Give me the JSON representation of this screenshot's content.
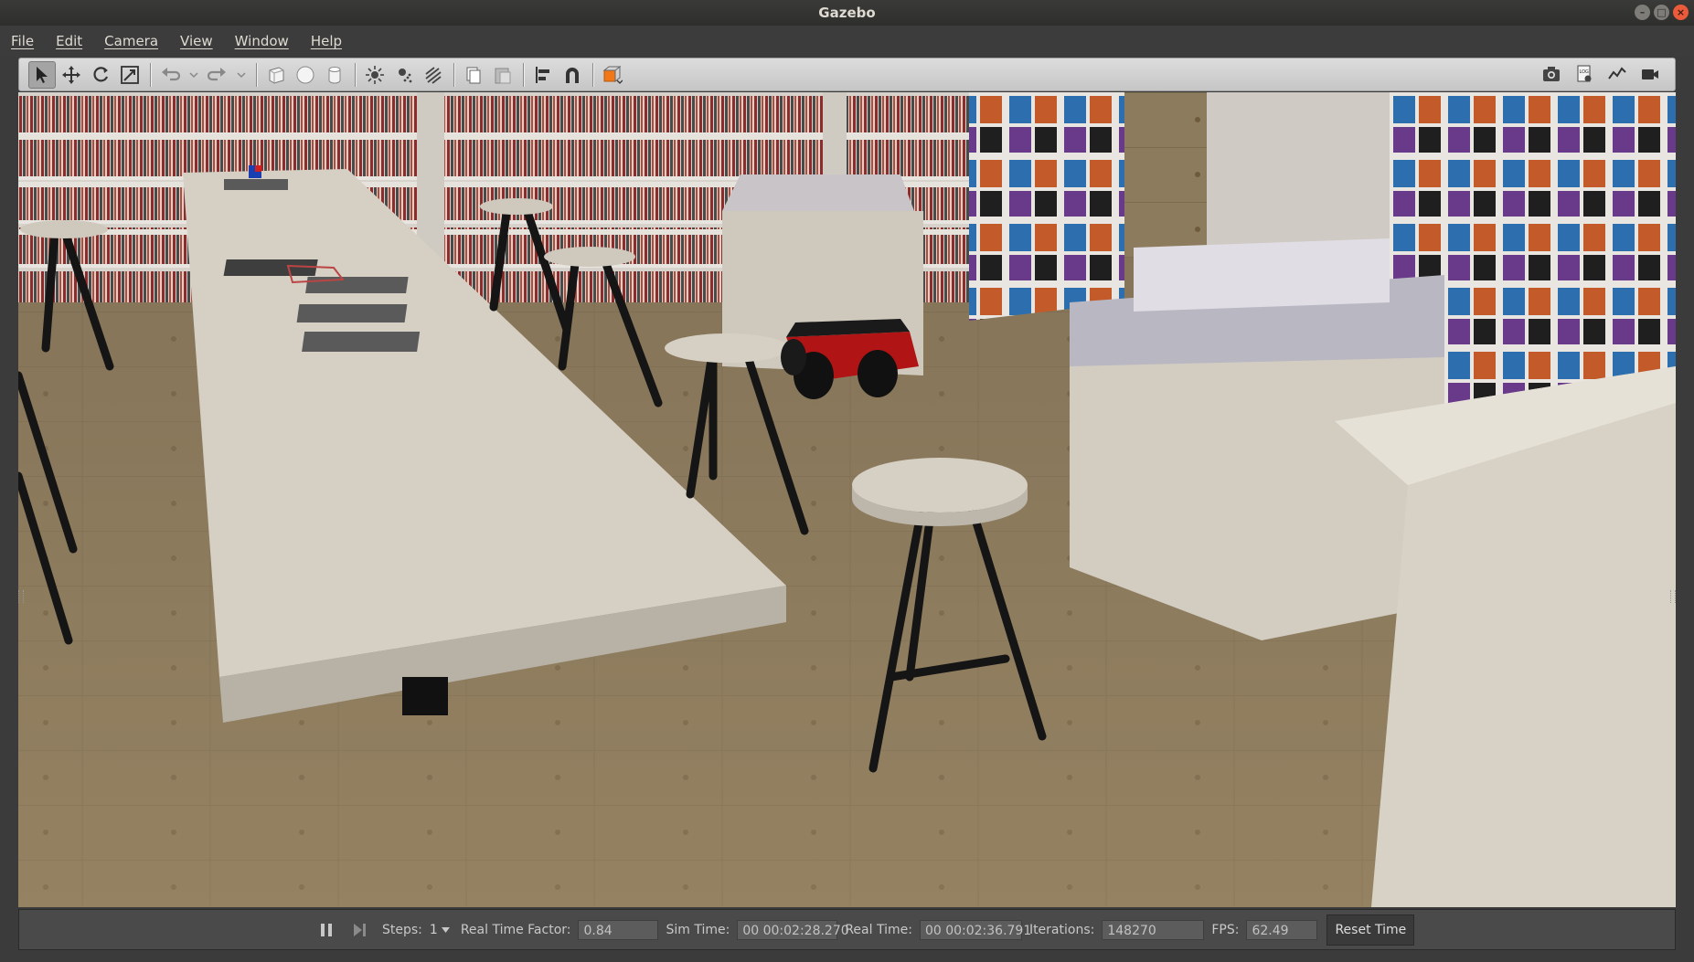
{
  "window": {
    "title": "Gazebo"
  },
  "menubar": {
    "items": [
      "File",
      "Edit",
      "Camera",
      "View",
      "Window",
      "Help"
    ]
  },
  "toolbar": {
    "tools": [
      "select-mode-icon",
      "translate-mode-icon",
      "rotate-mode-icon",
      "scale-mode-icon",
      "undo-icon",
      "redo-icon",
      "box-shape-icon",
      "sphere-shape-icon",
      "cylinder-shape-icon",
      "point-light-icon",
      "spot-light-icon",
      "directional-light-icon",
      "copy-icon",
      "paste-icon",
      "align-icon",
      "snap-icon",
      "view-angle-icon",
      "screenshot-icon",
      "log-icon",
      "plot-icon",
      "record-video-icon"
    ]
  },
  "bottombar": {
    "steps_label": "Steps:",
    "steps_value": "1",
    "rtf_label": "Real Time Factor:",
    "rtf_value": "0.84",
    "sim_time_label": "Sim Time:",
    "sim_time_value": "00 00:02:28.270",
    "real_time_label": "Real Time:",
    "real_time_value": "00 00:02:36.791",
    "iterations_label": "Iterations:",
    "iterations_value": "148270",
    "fps_label": "FPS:",
    "fps_value": "62.49",
    "reset_label": "Reset Time"
  },
  "scene": {
    "description_colors": {
      "floor": "#8f7d5e",
      "table_top": "#d6d0c4",
      "stool_leg": "#151515",
      "robot_body": "#b01414"
    }
  }
}
